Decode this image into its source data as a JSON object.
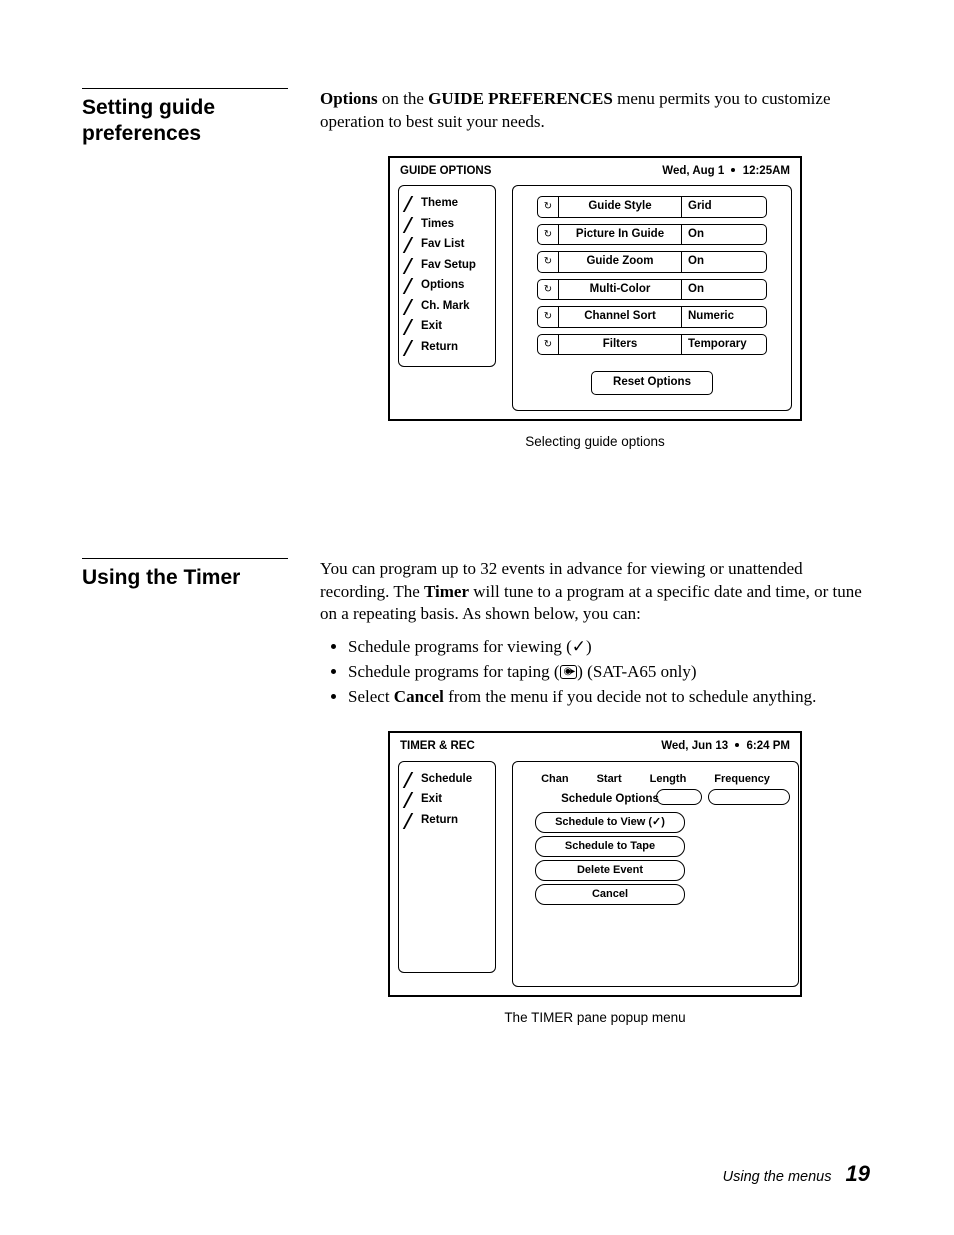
{
  "section1": {
    "title": "Setting guide preferences",
    "intro_pre_bold1": "Options",
    "intro_mid1": " on the ",
    "intro_bold2": "GUIDE PREFERENCES",
    "intro_post": " menu permits you to customize operation to best suit your needs.",
    "caption": "Selecting guide options"
  },
  "guide_panel": {
    "title": "GUIDE OPTIONS",
    "date": "Wed, Aug 1",
    "time": "12:25AM",
    "side_items": [
      "Theme",
      "Times",
      "Fav List",
      "Fav Setup",
      "Options",
      "Ch. Mark",
      "Exit",
      "Return"
    ],
    "options": [
      {
        "label": "Guide Style",
        "value": "Grid"
      },
      {
        "label": "Picture In Guide",
        "value": "On"
      },
      {
        "label": "Guide Zoom",
        "value": "On"
      },
      {
        "label": "Multi-Color",
        "value": "On"
      },
      {
        "label": "Channel Sort",
        "value": "Numeric"
      },
      {
        "label": "Filters",
        "value": "Temporary"
      }
    ],
    "reset": "Reset Options"
  },
  "section2": {
    "title": "Using the Timer",
    "para_pre": "You can program up to 32 events in advance for viewing or unattended recording. The ",
    "para_bold": "Timer",
    "para_post": " will tune to a program at a specific date and time, or tune on a repeating basis. As shown below, you can:",
    "bullets": {
      "b1": "Schedule programs for viewing (✓)",
      "b2_pre": "Schedule programs for taping (",
      "b2_post": ") (SAT-A65 only)",
      "b3_pre": "Select ",
      "b3_bold": "Cancel",
      "b3_post": " from the menu if you decide not to schedule anything."
    },
    "caption": "The TIMER pane popup menu"
  },
  "timer_panel": {
    "title": "TIMER & REC",
    "date": "Wed, Jun 13",
    "time": "6:24 PM",
    "side_items": [
      "Schedule",
      "Exit",
      "Return"
    ],
    "columns": [
      "Chan",
      "Start",
      "Length",
      "Frequency"
    ],
    "popup_title": "Schedule Options",
    "popup_items": [
      "Schedule to View (✓)",
      "Schedule to Tape",
      "Delete Event",
      "Cancel"
    ]
  },
  "footer": {
    "text": "Using the menus",
    "page": "19"
  },
  "icons": {
    "cycle": "↻",
    "tape": "◉▸"
  }
}
